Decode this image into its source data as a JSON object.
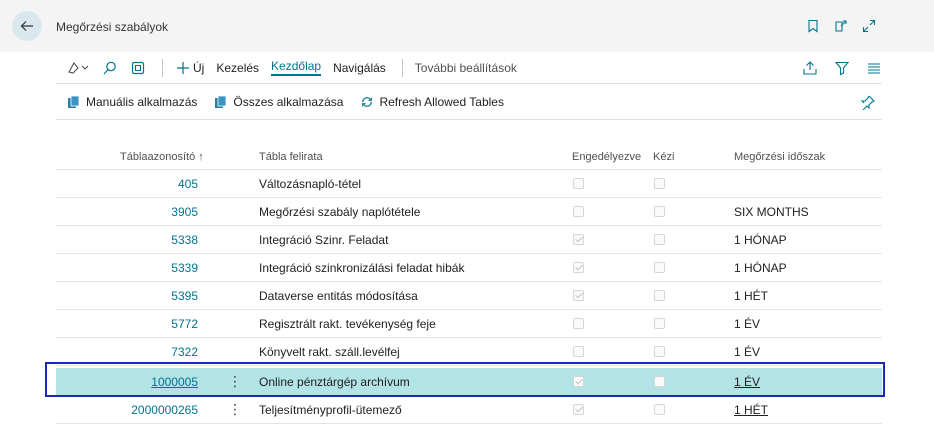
{
  "header": {
    "title": "Megőrzési szabályok"
  },
  "actions": {
    "new_label": "Új",
    "manage_label": "Kezelés",
    "home_label": "Kezdőlap",
    "navigate_label": "Navigálás",
    "more_label": "További beállítások"
  },
  "promoted": {
    "manual_label": "Manuális alkalmazás",
    "all_label": "Összes alkalmazása",
    "refresh_label": "Refresh Allowed Tables"
  },
  "columns": {
    "table_id": "Táblaazonosító ↑",
    "caption": "Tábla felirata",
    "enabled": "Engedélyezve",
    "manual": "Kézi",
    "period": "Megőrzési időszak"
  },
  "rows": [
    {
      "id": "405",
      "name": "Változásnapló-tétel",
      "enabled": false,
      "manual": false,
      "period": ""
    },
    {
      "id": "3905",
      "name": "Megőrzési szabály naplótétele",
      "enabled": false,
      "manual": false,
      "period": "SIX MONTHS"
    },
    {
      "id": "5338",
      "name": "Integráció Szinr. Feladat",
      "enabled": true,
      "manual": false,
      "period": "1 HÓNAP"
    },
    {
      "id": "5339",
      "name": "Integráció szinkronizálási feladat hibák",
      "enabled": true,
      "manual": false,
      "period": "1 HÓNAP"
    },
    {
      "id": "5395",
      "name": "Dataverse entitás módosítása",
      "enabled": true,
      "manual": false,
      "period": "1 HÉT"
    },
    {
      "id": "5772",
      "name": "Regisztrált rakt. tevékenység feje",
      "enabled": false,
      "manual": false,
      "period": "1 ÉV"
    },
    {
      "id": "7322",
      "name": "Könyvelt rakt. száll.levélfej",
      "enabled": false,
      "manual": false,
      "period": "1 ÉV"
    },
    {
      "id": "1000005",
      "name": "Online pénztárgép archívum",
      "enabled": true,
      "manual": false,
      "period": "1 ÉV"
    },
    {
      "id": "2000000265",
      "name": "Teljesítményprofil-ütemező",
      "enabled": true,
      "manual": false,
      "period": "1 HÉT"
    }
  ],
  "selected_row": 7,
  "colors": {
    "accent": "#00758f",
    "selected_bg": "#b2e3e6",
    "focus_border": "#1a2aaf"
  }
}
